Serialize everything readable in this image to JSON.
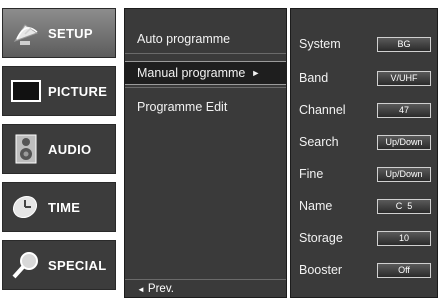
{
  "categories": [
    {
      "label": "SETUP",
      "icon": "satellite-dish-icon"
    },
    {
      "label": "PICTURE",
      "icon": "monitor-icon"
    },
    {
      "label": "AUDIO",
      "icon": "speaker-icon"
    },
    {
      "label": "TIME",
      "icon": "clock-icon"
    },
    {
      "label": "SPECIAL",
      "icon": "magnifier-icon"
    }
  ],
  "menu": {
    "items": [
      {
        "label": "Auto programme"
      },
      {
        "label": "Manual programme",
        "arrow": "►"
      },
      {
        "label": "Programme Edit"
      }
    ],
    "prev_label": "Prev.",
    "prev_arrow": "◄"
  },
  "settings": [
    {
      "label": "System",
      "value": "BG"
    },
    {
      "label": "Band",
      "value": "V/UHF"
    },
    {
      "label": "Channel",
      "value": "47"
    },
    {
      "label": "Search",
      "value": "Up/Down"
    },
    {
      "label": "Fine",
      "value": "Up/Down"
    },
    {
      "label": "Name",
      "value": "C  5"
    },
    {
      "label": "Storage",
      "value": "10"
    },
    {
      "label": "Booster",
      "value": "Off"
    }
  ],
  "colors": {
    "panel_bg": "#3a3a3a",
    "selected_bg": "#1e1e1e",
    "active_category_bg": "#7a7a7a",
    "text": "#ffffff"
  }
}
